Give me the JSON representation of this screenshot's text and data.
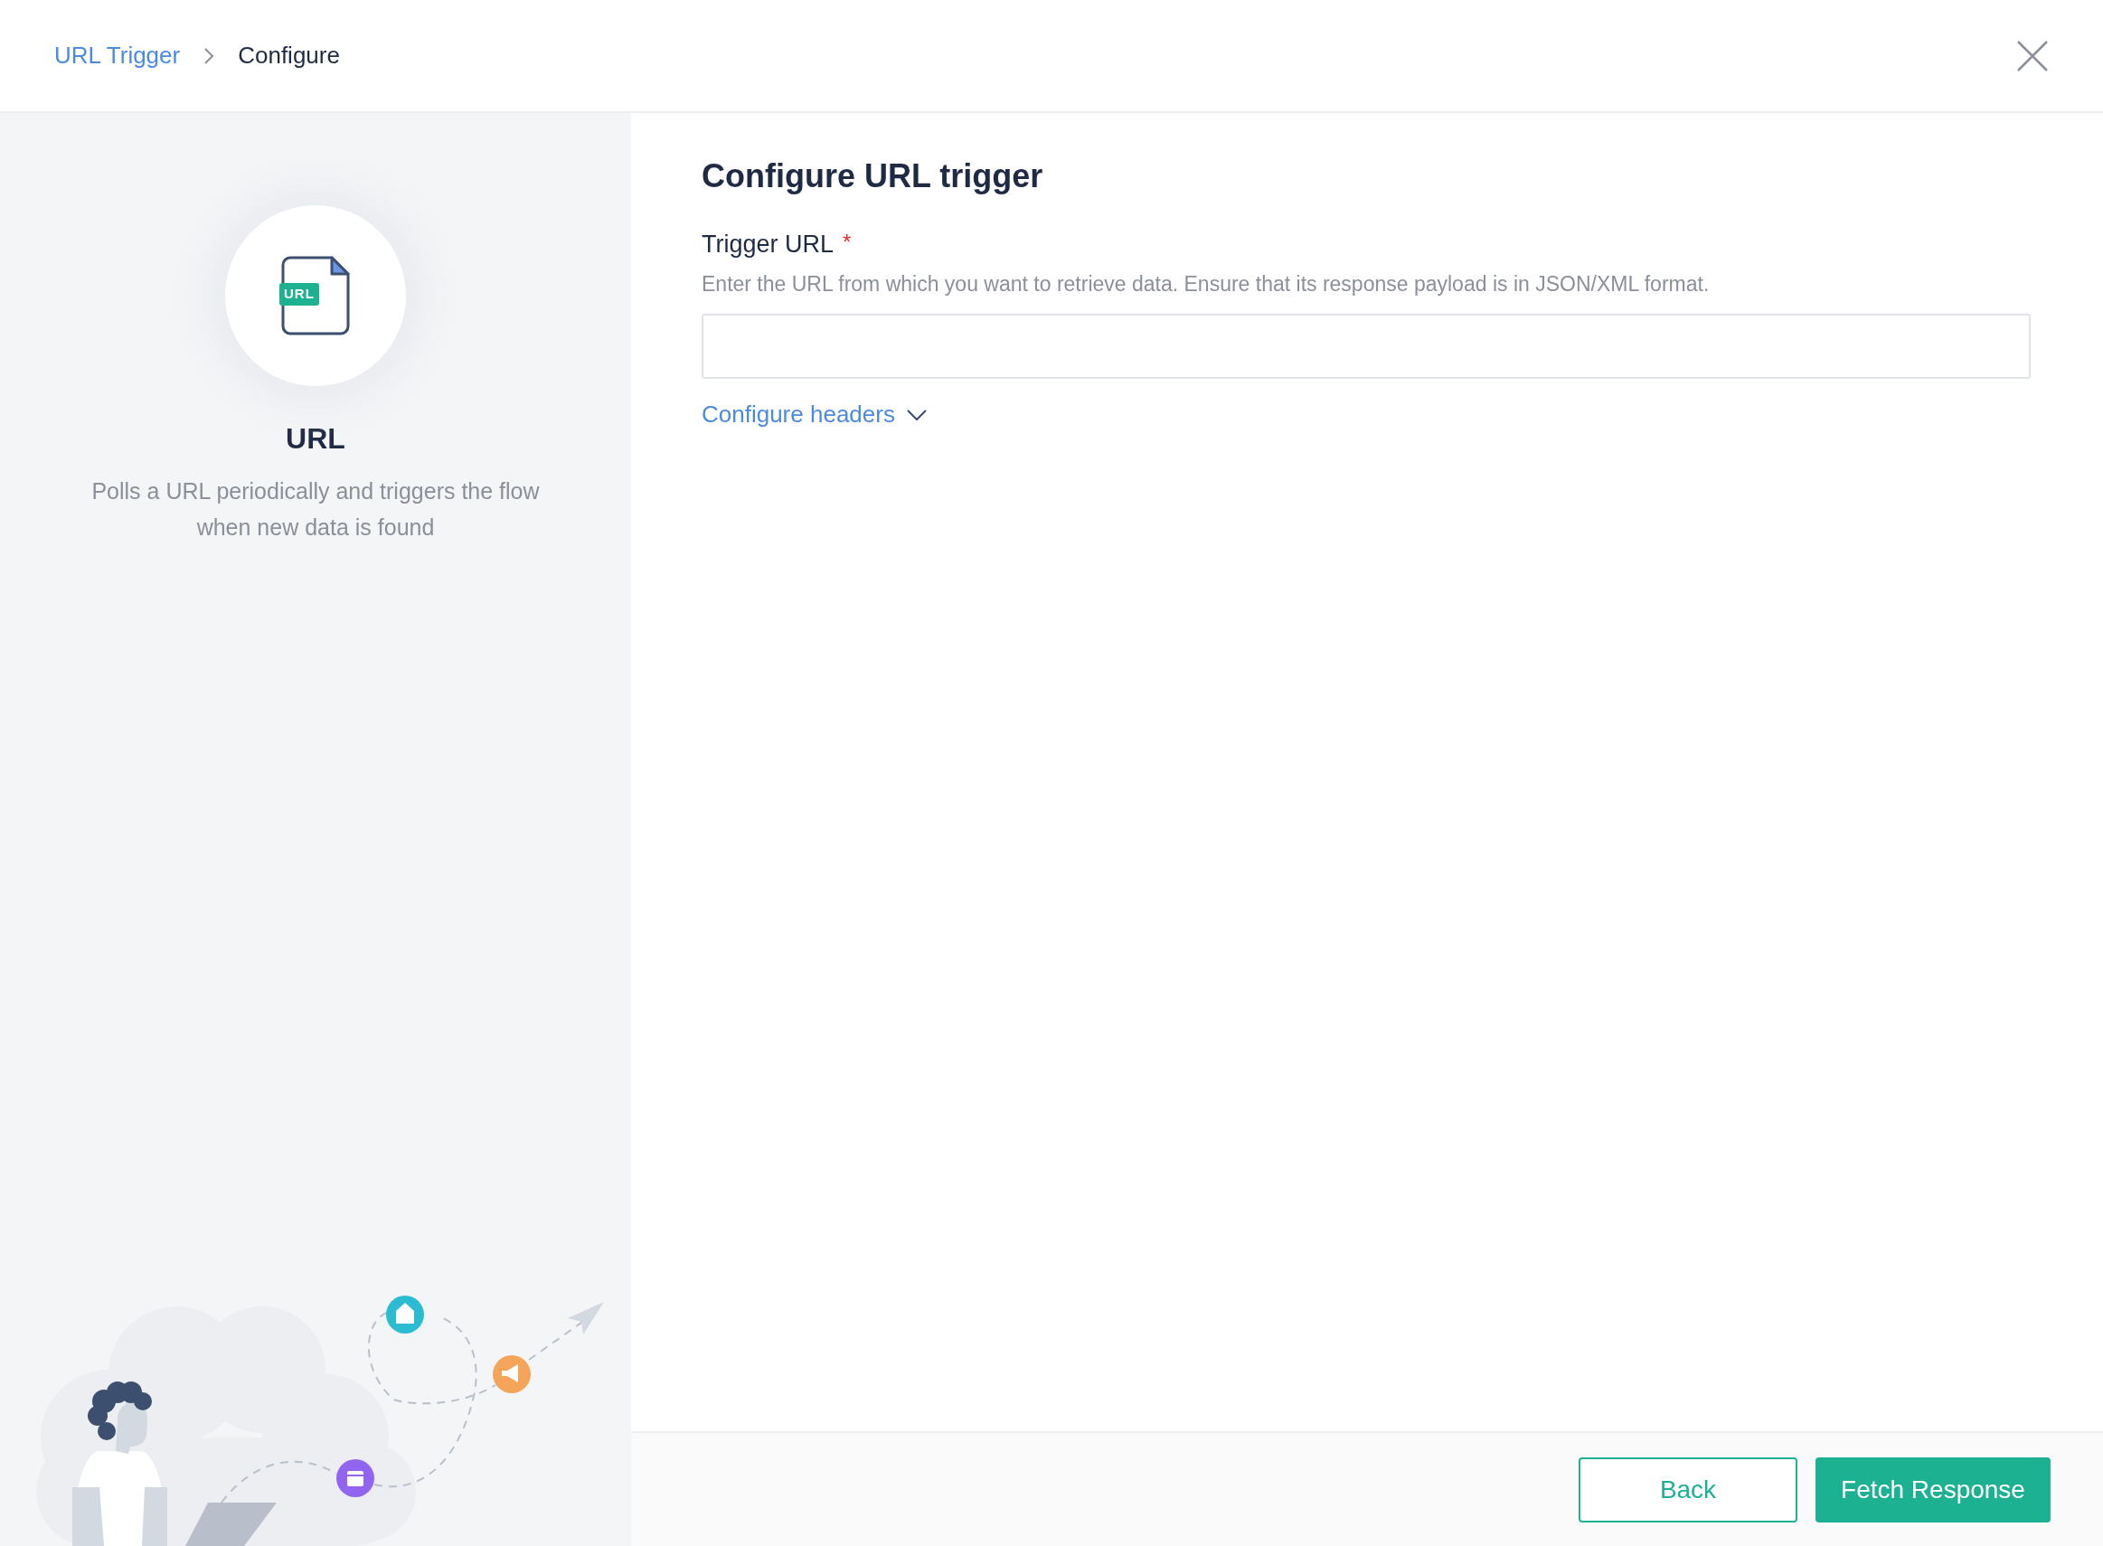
{
  "breadcrumb": [
    {
      "label": "URL Trigger",
      "kind": "link"
    },
    {
      "label": "Configure",
      "kind": "current"
    }
  ],
  "trigger": {
    "badge": "URL",
    "name": "URL",
    "description": "Polls a URL periodically and triggers the flow when new data is found"
  },
  "form": {
    "title": "Configure URL trigger",
    "field": {
      "label": "Trigger URL",
      "required_mark": "*",
      "help": "Enter the URL from which you want to retrieve data. Ensure that its response payload is in JSON/XML format."
    },
    "headers_toggle": {
      "label": "Configure headers",
      "expanded": false
    }
  },
  "buttons": [
    {
      "label": "Back",
      "kind": "outline"
    },
    {
      "label": "Fetch Response",
      "kind": "primary"
    }
  ]
}
